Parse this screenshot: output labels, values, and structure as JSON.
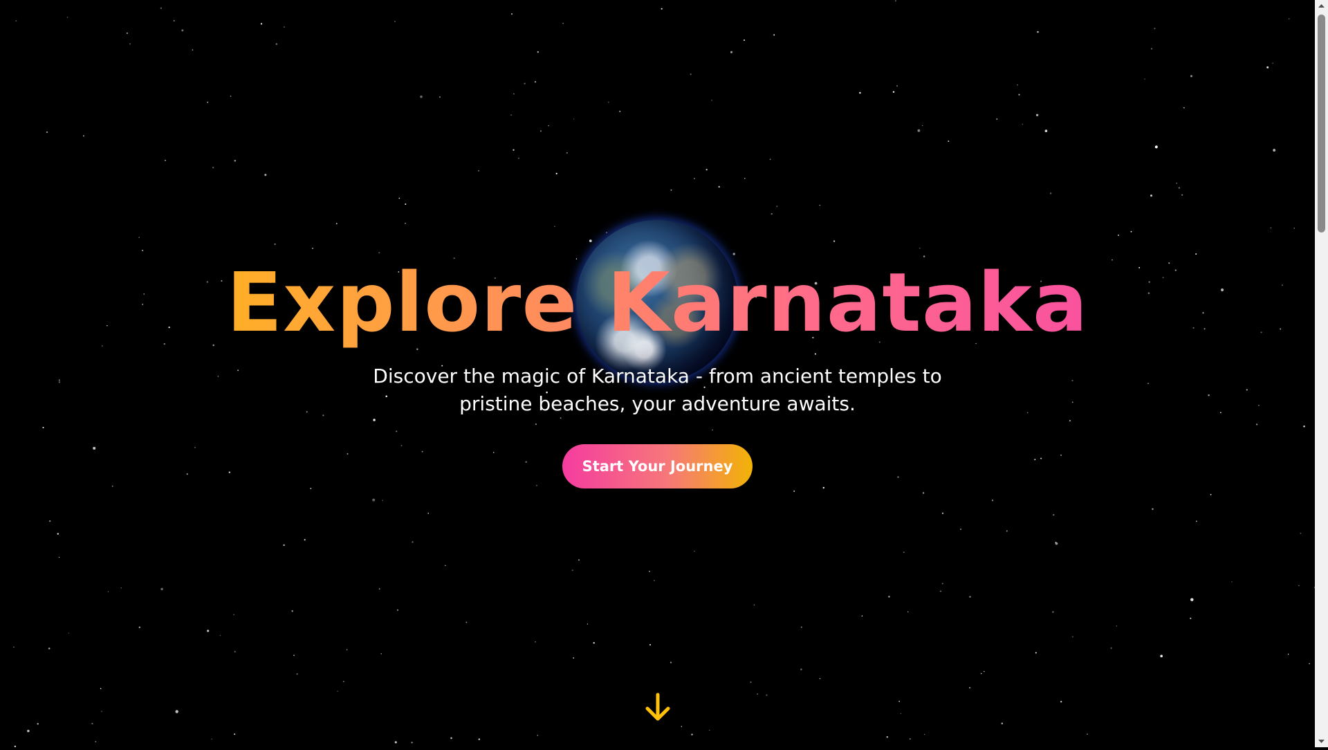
{
  "hero": {
    "title": "Explore Karnataka",
    "subtitle": "Discover the magic of Karnataka - from ancient temples to pristine beaches, your adventure awaits.",
    "cta_label": "Start Your Journey"
  },
  "icons": {
    "globe": "earth-globe",
    "scroll": "arrow-down-icon"
  },
  "colors": {
    "background": "#000000",
    "title_gradient": [
      "#ffc400",
      "#ff9f43",
      "#ff6b8a",
      "#f53db0"
    ],
    "button_gradient": [
      "#f53ca0",
      "#f6777a",
      "#f2b305"
    ],
    "arrow": "#ffc107",
    "text": "#ffffff"
  }
}
